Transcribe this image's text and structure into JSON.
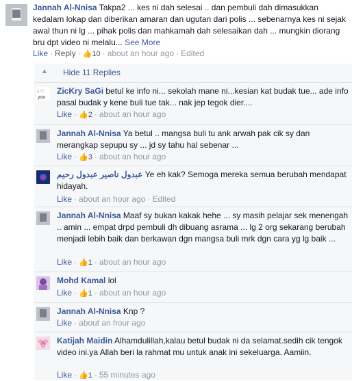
{
  "top": {
    "author": "Jannah Al-Nnisa",
    "text": "Takpa2 ... kes ni dah selesai .. dan pembuli dah dimasukkan kedalam lokap dan diberikan amaran dan ugutan dari polis ... sebenarnya kes ni sejak awal thun ni lg ... pihak polis dan mahkamah dah selesaikan dah ... mungkin diorang bru dpt video ni melalu...",
    "see_more": "See More",
    "like": "Like",
    "reply": "Reply",
    "likes": "10",
    "time": "about an hour ago",
    "edited": "Edited"
  },
  "hide_label": "Hide 11 Replies",
  "replies": [
    {
      "author": "ZicKry SaGi",
      "text": "betul ke info ni... sekolah mane ni...kesian kat budak tue... ade info pasal budak y kene buli tue tak... nak jep tegok dier....",
      "like": "Like",
      "likes": "2",
      "time": "about an hour ago",
      "edited": ""
    },
    {
      "author": "Jannah Al-Nnisa",
      "text": "Ya betul .. mangsa buli tu ank arwah pak cik sy dan merangkap sepupu sy ... jd sy tahu hal sebenar ...",
      "like": "Like",
      "likes": "3",
      "time": "about an hour ago",
      "edited": ""
    },
    {
      "author": "عبدول ناصير عبدول رحيم",
      "text": "Ye eh kak? Semoga mereka semua berubah mendapat hidayah.",
      "like": "Like",
      "likes": "",
      "time": "about an hour ago",
      "edited": "Edited"
    },
    {
      "author": "Jannah Al-Nnisa",
      "text": "Maaf sy bukan kakak hehe ... sy masih pelajar sek menengah .. amin ... empat drpd pembuli dh dibuang asrama ... lg 2 org sekarang berubah menjadi lebih baik dan berkawan dgn mangsa buli mrk dgn cara yg lg baik ...",
      "like": "Like",
      "likes": "1",
      "time": "about an hour ago",
      "edited": ""
    },
    {
      "author": "Mohd Kamal",
      "text": "lol",
      "like": "Like",
      "likes": "1",
      "time": "about an hour ago",
      "edited": ""
    },
    {
      "author": "Jannah Al-Nnisa",
      "text": "Knp ?",
      "like": "Like",
      "likes": "",
      "time": "about an hour ago",
      "edited": ""
    },
    {
      "author": "Katijah Maidin",
      "text": "Alhamdulillah,kalau betul budak ni da selamat.sedih cik tengok video ini.ya Allah beri la rahmat mu untuk anak ini sekeluarga. Aamiin.",
      "like": "Like",
      "likes": "1",
      "time": "55 minutes ago",
      "edited": ""
    }
  ]
}
